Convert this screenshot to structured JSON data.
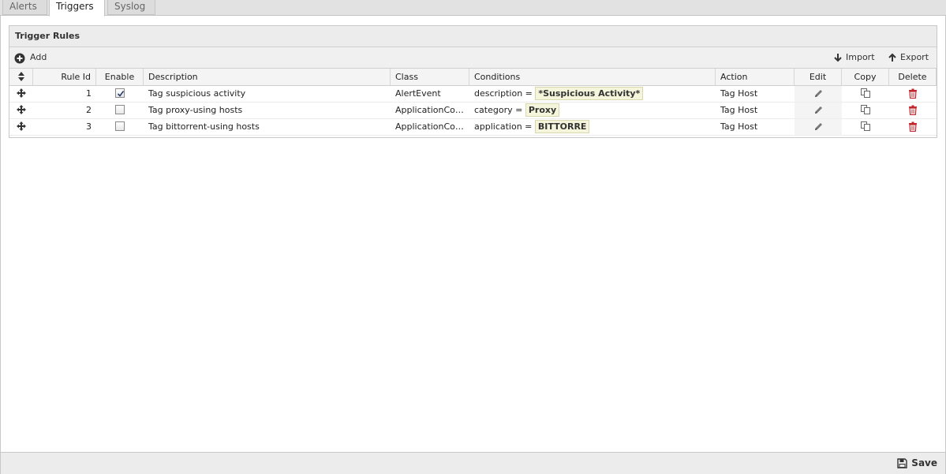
{
  "tabs": [
    {
      "label": "Alerts",
      "active": false
    },
    {
      "label": "Triggers",
      "active": true
    },
    {
      "label": "Syslog",
      "active": false
    }
  ],
  "grid": {
    "title": "Trigger Rules",
    "toolbar": {
      "add_label": "Add",
      "import_label": "Import",
      "export_label": "Export"
    },
    "columns": {
      "rule_id": "Rule Id",
      "enable": "Enable",
      "description": "Description",
      "class": "Class",
      "conditions": "Conditions",
      "action": "Action",
      "edit": "Edit",
      "copy": "Copy",
      "delete": "Delete"
    },
    "rows": [
      {
        "rule_id": "1",
        "enabled": true,
        "description": "Tag suspicious activity",
        "class": "AlertEvent",
        "cond_key": "description =",
        "cond_val": "*Suspicious Activity*",
        "action": "Tag Host"
      },
      {
        "rule_id": "2",
        "enabled": false,
        "description": "Tag proxy-using hosts",
        "class": "ApplicationControlLogEvent",
        "cond_key": "category =",
        "cond_val": "Proxy",
        "action": "Tag Host"
      },
      {
        "rule_id": "3",
        "enabled": false,
        "description": "Tag bittorrent-using hosts",
        "class": "ApplicationControlLogEvent",
        "cond_key": "application =",
        "cond_val": "BITTORRE",
        "action": "Tag Host"
      }
    ]
  },
  "footer": {
    "save_label": "Save"
  },
  "colors": {
    "delete_icon": "#c0262c",
    "condition_bg": "#f5f5dc"
  }
}
